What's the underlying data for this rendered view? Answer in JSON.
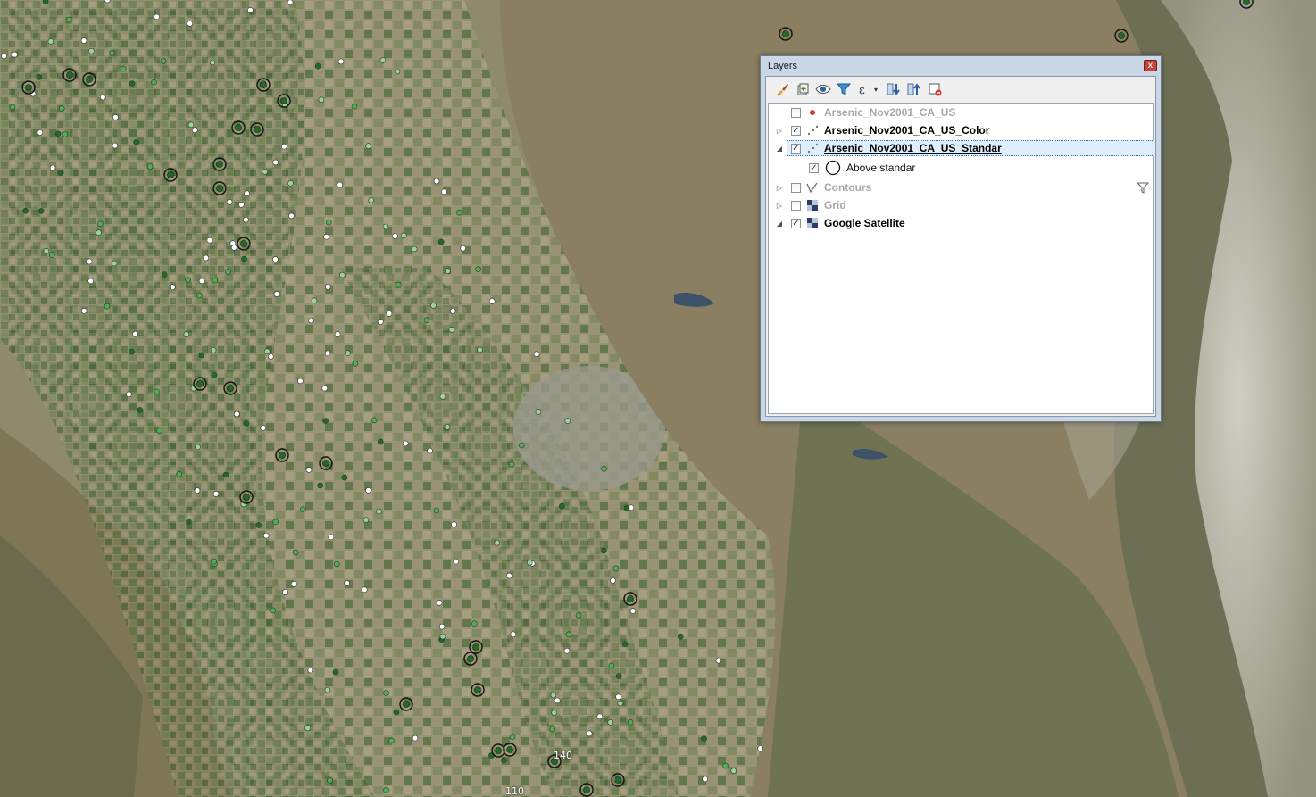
{
  "map": {
    "description_colors": {
      "valley": "#8f8a6a",
      "fields": "#5d7a4a",
      "mountains": "#6f7a58",
      "snow": "#d8d4cc"
    },
    "contour_labels": [
      "140",
      "110"
    ],
    "point_colors": {
      "white": "#ffffff",
      "light_green": "#9ad49a",
      "mid_green": "#4caf50",
      "dark_green": "#1f6b2a",
      "ring": "#111111"
    }
  },
  "layers_panel": {
    "title": "Layers",
    "close_label": "x",
    "toolbar": [
      {
        "icon": "style-brush-icon"
      },
      {
        "icon": "add-group-icon"
      },
      {
        "icon": "visibility-eye-icon"
      },
      {
        "icon": "filter-legend-icon"
      },
      {
        "icon": "filter-expression-icon",
        "dropdown": "▾"
      },
      {
        "icon": "expand-all-icon"
      },
      {
        "icon": "collapse-all-icon"
      },
      {
        "icon": "remove-layer-icon"
      }
    ],
    "layers": [
      {
        "name": "Arsenic_Nov2001_CA_US",
        "checked": false,
        "expandable": false,
        "expanded": false,
        "style": "gray",
        "icon": "point-red-icon"
      },
      {
        "name": "Arsenic_Nov2001_CA_US_Color",
        "checked": true,
        "expandable": true,
        "expanded": false,
        "style": "bold",
        "icon": "point-layer-icon"
      },
      {
        "name": "Arsenic_Nov2001_CA_US_Standar",
        "checked": true,
        "expandable": true,
        "expanded": true,
        "style": "bold",
        "selected": true,
        "icon": "point-layer-icon"
      },
      {
        "name": "Above standar",
        "checked": true,
        "child": true,
        "style": "normal",
        "icon": "circle-symbol-icon"
      },
      {
        "name": "Contours",
        "checked": false,
        "expandable": true,
        "expanded": false,
        "style": "gray",
        "icon": "line-layer-icon",
        "filter": true
      },
      {
        "name": "Grid",
        "checked": false,
        "expandable": true,
        "expanded": false,
        "style": "gray",
        "icon": "raster-layer-icon"
      },
      {
        "name": "Google Satellite",
        "checked": true,
        "expandable": true,
        "expanded": true,
        "style": "bold",
        "icon": "raster-layer-icon"
      }
    ],
    "check_mark": "✓",
    "arrow_collapsed": "▷",
    "arrow_expanded": "◢"
  }
}
